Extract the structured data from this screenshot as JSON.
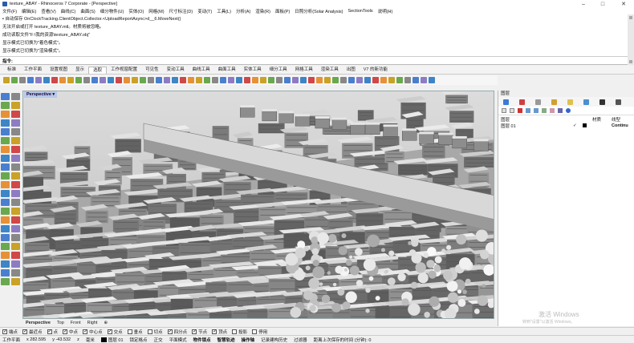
{
  "window": {
    "title": "texture_ABAY - Rhinoceros 7 Corporate - [Perspective]",
    "minimize": "–",
    "maximize": "□",
    "close": "✕"
  },
  "menu": [
    "文件(F)",
    "编辑(E)",
    "查看(V)",
    "曲线(C)",
    "曲面(S)",
    "细分物件(U)",
    "实体(O)",
    "网格(M)",
    "尺寸标注(D)",
    "变动(T)",
    "工具(L)",
    "分析(A)",
    "渲染(R)",
    "面板(P)",
    "日照分析(Solar Analysis)",
    "SectionTools",
    "说明(H)"
  ],
  "command_history": [
    "▪ 自动保存 OnClockTracking.ClientObject.Collector.<UploadReportAsync>d__6.MoveNext()",
    "无法开启或打开 texture_ABAY.mtl。材质将被忽略。",
    "成功读取文件\"F:\\我的资源\\texture_ABAY.obj\"",
    "显示模式已切换为\"着色模式\"。",
    "显示模式已切换为\"渲染模式\"。"
  ],
  "command_prompt": "指令:",
  "tabs": [
    "标准",
    "工作平面",
    "设置视图",
    "显示",
    "选取",
    "工作视窗配置",
    "可见性",
    "变动工具",
    "曲线工具",
    "曲面工具",
    "实体工具",
    "细分工具",
    "网格工具",
    "渲染工具",
    "出图",
    "V7 的新功能"
  ],
  "active_tab_index": 4,
  "viewport": {
    "label": "Perspective"
  },
  "view_tabs": [
    "Perspective",
    "Top",
    "Front",
    "Right",
    "⊕"
  ],
  "layers_panel": {
    "title": "图层",
    "columns": [
      "图层",
      "",
      "",
      "材质",
      "线型"
    ],
    "rows": [
      {
        "name": "图层 01",
        "check": "✓",
        "color": "#000000",
        "linetype": "Continu"
      }
    ]
  },
  "watermark": {
    "line1": "激活 Windows",
    "line2": "转到\"设置\"以激活 Windows。"
  },
  "osnap": [
    {
      "label": "端点",
      "on": true
    },
    {
      "label": "最近点",
      "on": true
    },
    {
      "label": "点",
      "on": true
    },
    {
      "label": "中点",
      "on": true
    },
    {
      "label": "中心点",
      "on": true
    },
    {
      "label": "交点",
      "on": true
    },
    {
      "label": "垂点",
      "on": false
    },
    {
      "label": "切点",
      "on": false
    },
    {
      "label": "四分点",
      "on": true
    },
    {
      "label": "节点",
      "on": true
    },
    {
      "label": "顶点",
      "on": true
    },
    {
      "label": "投影",
      "on": false
    },
    {
      "label": "停用",
      "on": false
    }
  ],
  "status": {
    "cplane": "工作平面",
    "x": "x 282.595",
    "y": "y -43.532",
    "z": "z",
    "unit": "毫米",
    "layer": "图层 01",
    "items": [
      "锁定格点",
      "正交",
      "平面模式",
      "物件锁点",
      "智慧轨迹",
      "操作轴",
      "记录建构历史",
      "过滤器",
      "距离上次保存的时间 (分钟): 0"
    ]
  }
}
